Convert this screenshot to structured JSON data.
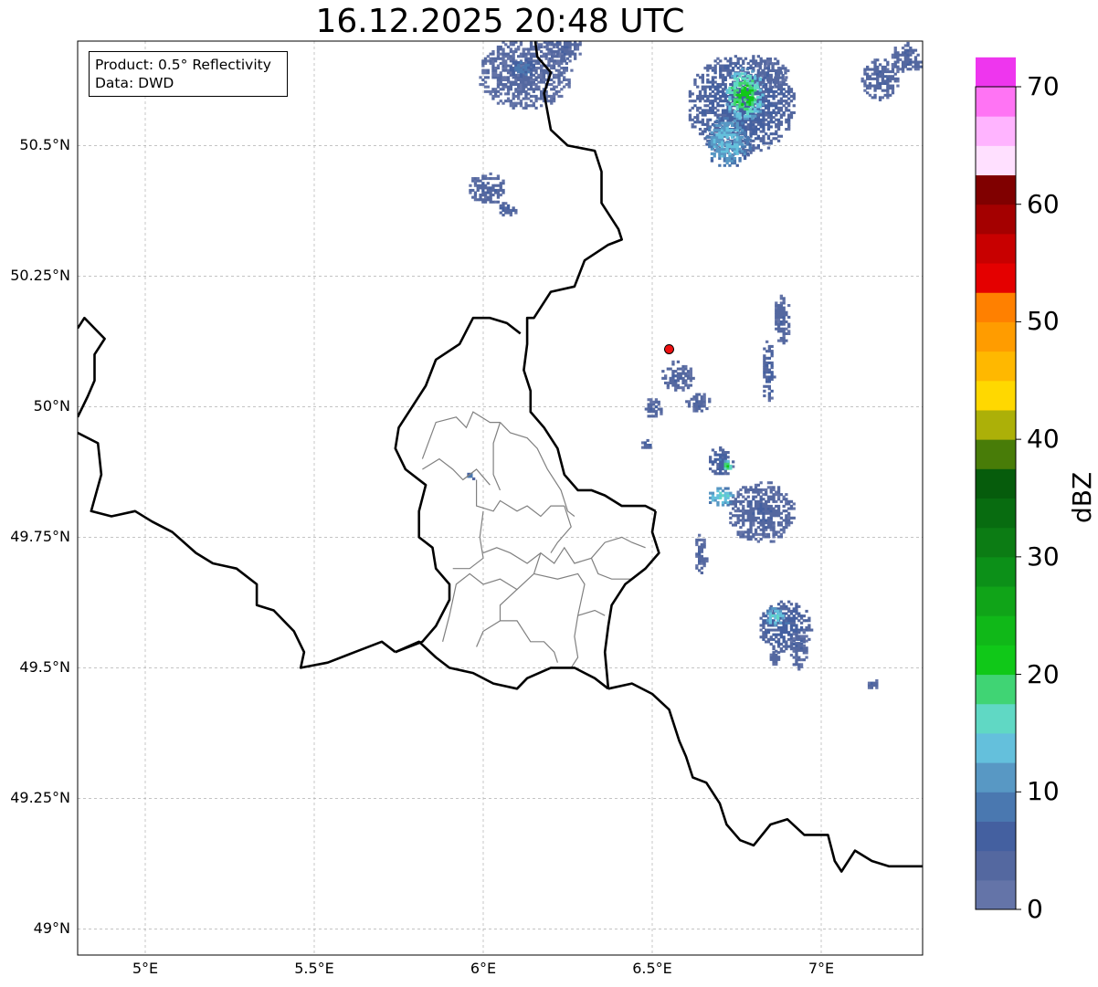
{
  "title": "16.12.2025 20:48 UTC",
  "info_box": {
    "product": "Product: 0.5° Reflectivity",
    "data": "Data: DWD"
  },
  "map": {
    "lon_ticks": [
      {
        "value": 5.0,
        "label": "5°E"
      },
      {
        "value": 5.5,
        "label": "5.5°E"
      },
      {
        "value": 6.0,
        "label": "6°E"
      },
      {
        "value": 6.5,
        "label": "6.5°E"
      },
      {
        "value": 7.0,
        "label": "7°E"
      }
    ],
    "lat_ticks": [
      {
        "value": 50.5,
        "label": "50.5°N"
      },
      {
        "value": 50.25,
        "label": "50.25°N"
      },
      {
        "value": 50.0,
        "label": "50°N"
      },
      {
        "value": 49.75,
        "label": "49.75°N"
      },
      {
        "value": 49.5,
        "label": "49.5°N"
      },
      {
        "value": 49.25,
        "label": "49.25°N"
      },
      {
        "value": 49.0,
        "label": "49°N"
      }
    ],
    "extent": {
      "lon_min": 4.8,
      "lon_max": 7.3,
      "lat_min": 48.95,
      "lat_max": 50.7
    },
    "radar_site": {
      "lon": 6.55,
      "lat": 50.11,
      "color": "#ee1111"
    },
    "border_color": "#000000",
    "region_color": "#808080",
    "grid_color": "#b0b0b0"
  },
  "colorbar": {
    "label": "dBZ",
    "ticks": [
      {
        "value": 0,
        "label": "0"
      },
      {
        "value": 10,
        "label": "10"
      },
      {
        "value": 20,
        "label": "20"
      },
      {
        "value": 30,
        "label": "30"
      },
      {
        "value": 40,
        "label": "40"
      },
      {
        "value": 50,
        "label": "50"
      },
      {
        "value": 60,
        "label": "60"
      },
      {
        "value": 70,
        "label": "70"
      }
    ],
    "min": 0,
    "max": 70,
    "step": 2.5,
    "colors": [
      "#6474a8",
      "#5468a0",
      "#4460a0",
      "#4a78b0",
      "#5898c4",
      "#64c0dc",
      "#60d8c4",
      "#40d474",
      "#10c818",
      "#10b818",
      "#10a418",
      "#0c9018",
      "#0c7c14",
      "#086c10",
      "#065c0c",
      "#487c08",
      "#acb008",
      "#ffd800",
      "#ffb800",
      "#ff9c00",
      "#ff8000",
      "#e40000",
      "#c80000",
      "#a40000",
      "#800000",
      "#ffe0ff",
      "#ffb4ff",
      "#ff74f4",
      "#ee36ee"
    ]
  },
  "radar_cells": [
    {
      "lon": 6.12,
      "lat": 50.64,
      "rx": 0.14,
      "ry": 0.07,
      "dbz": 3
    },
    {
      "lon": 6.11,
      "lat": 50.65,
      "rx": 0.04,
      "ry": 0.02,
      "dbz": 8
    },
    {
      "lon": 6.23,
      "lat": 50.69,
      "rx": 0.06,
      "ry": 0.03,
      "dbz": 4
    },
    {
      "lon": 6.01,
      "lat": 50.42,
      "rx": 0.06,
      "ry": 0.03,
      "dbz": 4
    },
    {
      "lon": 6.07,
      "lat": 50.38,
      "rx": 0.03,
      "ry": 0.015,
      "dbz": 5
    },
    {
      "lon": 6.76,
      "lat": 50.58,
      "rx": 0.16,
      "ry": 0.1,
      "dbz": 6
    },
    {
      "lon": 6.77,
      "lat": 50.6,
      "rx": 0.06,
      "ry": 0.05,
      "dbz": 20
    },
    {
      "lon": 6.72,
      "lat": 50.51,
      "rx": 0.07,
      "ry": 0.05,
      "dbz": 13
    },
    {
      "lon": 6.85,
      "lat": 50.64,
      "rx": 0.05,
      "ry": 0.03,
      "dbz": 4
    },
    {
      "lon": 7.17,
      "lat": 50.63,
      "rx": 0.06,
      "ry": 0.04,
      "dbz": 4
    },
    {
      "lon": 7.25,
      "lat": 50.67,
      "rx": 0.05,
      "ry": 0.03,
      "dbz": 4
    },
    {
      "lon": 6.88,
      "lat": 50.17,
      "rx": 0.025,
      "ry": 0.05,
      "dbz": 4
    },
    {
      "lon": 6.84,
      "lat": 50.07,
      "rx": 0.02,
      "ry": 0.06,
      "dbz": 5
    },
    {
      "lon": 6.57,
      "lat": 50.06,
      "rx": 0.05,
      "ry": 0.03,
      "dbz": 4
    },
    {
      "lon": 6.5,
      "lat": 50.0,
      "rx": 0.03,
      "ry": 0.02,
      "dbz": 4
    },
    {
      "lon": 6.63,
      "lat": 50.01,
      "rx": 0.04,
      "ry": 0.02,
      "dbz": 4
    },
    {
      "lon": 6.48,
      "lat": 49.93,
      "rx": 0.02,
      "ry": 0.01,
      "dbz": 4
    },
    {
      "lon": 6.7,
      "lat": 49.9,
      "rx": 0.04,
      "ry": 0.03,
      "dbz": 6
    },
    {
      "lon": 6.72,
      "lat": 49.89,
      "rx": 0.015,
      "ry": 0.01,
      "dbz": 20
    },
    {
      "lon": 6.82,
      "lat": 49.8,
      "rx": 0.1,
      "ry": 0.06,
      "dbz": 4
    },
    {
      "lon": 6.7,
      "lat": 49.83,
      "rx": 0.04,
      "ry": 0.02,
      "dbz": 15
    },
    {
      "lon": 6.64,
      "lat": 49.72,
      "rx": 0.02,
      "ry": 0.04,
      "dbz": 4
    },
    {
      "lon": 6.89,
      "lat": 49.58,
      "rx": 0.08,
      "ry": 0.05,
      "dbz": 6
    },
    {
      "lon": 6.86,
      "lat": 49.6,
      "rx": 0.03,
      "ry": 0.02,
      "dbz": 15
    },
    {
      "lon": 6.93,
      "lat": 49.54,
      "rx": 0.03,
      "ry": 0.04,
      "dbz": 4
    },
    {
      "lon": 6.86,
      "lat": 49.52,
      "rx": 0.02,
      "ry": 0.015,
      "dbz": 4
    },
    {
      "lon": 5.96,
      "lat": 49.87,
      "rx": 0.015,
      "ry": 0.01,
      "dbz": 8
    },
    {
      "lon": 7.15,
      "lat": 49.47,
      "rx": 0.02,
      "ry": 0.01,
      "dbz": 4
    }
  ]
}
